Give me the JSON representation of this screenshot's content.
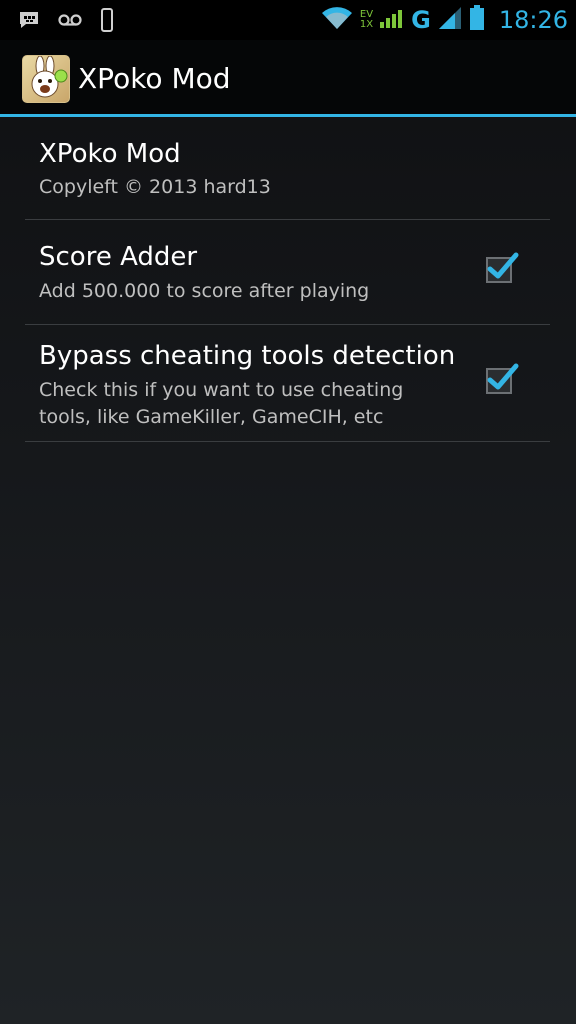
{
  "status_bar": {
    "network_type": "G",
    "ev_label_top": "EV",
    "ev_label_bottom": "1X",
    "time": "18:26",
    "icons": [
      "bbm-icon",
      "voicemail-icon",
      "phone-icon",
      "wifi-icon",
      "signal-icon",
      "battery-icon"
    ]
  },
  "action_bar": {
    "title": "XPoko Mod",
    "app_icon": "app-icon-rabbit"
  },
  "preferences": {
    "about": {
      "title": "XPoko Mod",
      "summary": "Copyleft © 2013 hard13"
    },
    "score_adder": {
      "title": "Score Adder",
      "summary": "Add 500.000 to score after playing",
      "checked": true
    },
    "bypass": {
      "title": "Bypass cheating tools detection",
      "summary": "Check this if you want to use cheating tools, like GameKiller, GameCIH, etc",
      "checked": true
    }
  },
  "colors": {
    "accent": "#33b5e5",
    "background": "#15171a",
    "divider": "#3a3d40",
    "text_primary": "#ffffff",
    "text_secondary": "#bfbfbf"
  }
}
